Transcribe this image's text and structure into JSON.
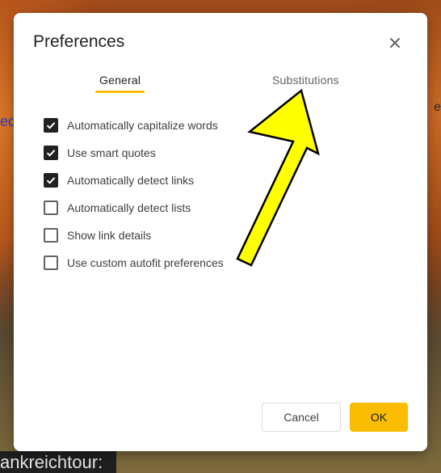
{
  "background": {
    "left_text": "ec",
    "right_text": "e",
    "caption": "ankreichtour:"
  },
  "dialog": {
    "title": "Preferences",
    "close_icon": "close-icon",
    "tabs": [
      {
        "label": "General",
        "active": true
      },
      {
        "label": "Substitutions",
        "active": false
      }
    ],
    "options": [
      {
        "label": "Automatically capitalize words",
        "checked": true
      },
      {
        "label": "Use smart quotes",
        "checked": true
      },
      {
        "label": "Automatically detect links",
        "checked": true
      },
      {
        "label": "Automatically detect lists",
        "checked": false
      },
      {
        "label": "Show link details",
        "checked": false
      },
      {
        "label": "Use custom autofit preferences",
        "checked": false
      }
    ],
    "buttons": {
      "cancel": "Cancel",
      "ok": "OK"
    },
    "colors": {
      "accent": "#fbbc04",
      "annotation_arrow": "#ffff00"
    }
  }
}
